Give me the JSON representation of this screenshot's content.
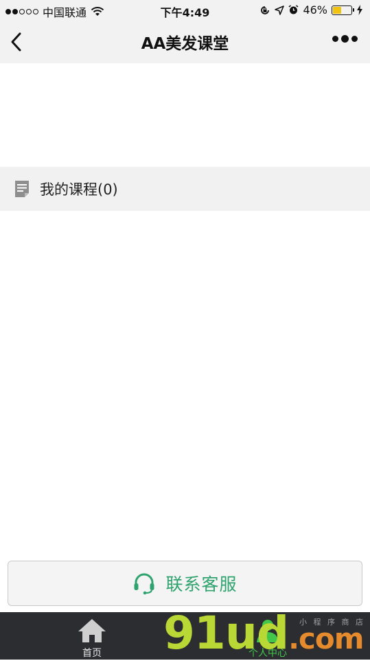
{
  "status_bar": {
    "carrier": "中国联通",
    "time": "下午4:49",
    "battery": "46%",
    "battery_level": 0.46
  },
  "nav": {
    "title": "AA美发课堂"
  },
  "section": {
    "title": "我的课程(0)"
  },
  "contact": {
    "label": "联系客服"
  },
  "tabs": [
    {
      "label": "首页",
      "icon": "home-icon",
      "active": false
    },
    {
      "label": "个人中心",
      "icon": "person-icon",
      "active": true
    }
  ],
  "watermark": {
    "brand_left": "91ud",
    "brand_right": ".com",
    "sub": "小 程 序 商 店"
  },
  "colors": {
    "accent_green": "#2ea36d",
    "tab_active": "#43c74a",
    "tabbar_bg": "#2b2d30"
  }
}
